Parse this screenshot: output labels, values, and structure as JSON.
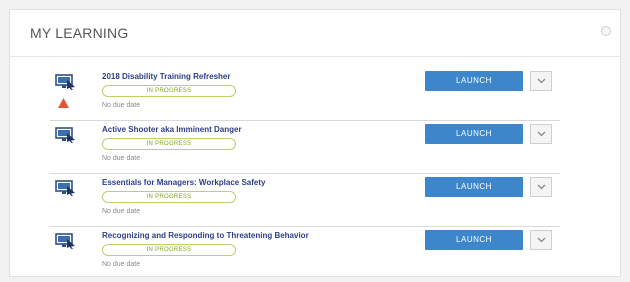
{
  "panel": {
    "title": "MY LEARNING"
  },
  "colors": {
    "launch_button": "#3d86cc",
    "course_title": "#2d3f86",
    "status_border": "#b9d26a",
    "status_text": "#7ea321",
    "warning": "#e2533a"
  },
  "courses": [
    {
      "title": "2018 Disability Training Refresher",
      "status": "IN PROGRESS",
      "due": "No due date",
      "launch_label": "LAUNCH",
      "icon": "computer-course-icon",
      "warning": true
    },
    {
      "title": "Active Shooter aka Imminent Danger",
      "status": "IN PROGRESS",
      "due": "No due date",
      "launch_label": "LAUNCH",
      "icon": "computer-course-icon",
      "warning": false
    },
    {
      "title": "Essentials for Managers: Workplace Safety",
      "status": "IN PROGRESS",
      "due": "No due date",
      "launch_label": "LAUNCH",
      "icon": "computer-course-icon",
      "warning": false
    },
    {
      "title": "Recognizing and Responding to Threatening Behavior",
      "status": "IN PROGRESS",
      "due": "No due date",
      "launch_label": "LAUNCH",
      "icon": "computer-course-icon",
      "warning": false
    }
  ]
}
